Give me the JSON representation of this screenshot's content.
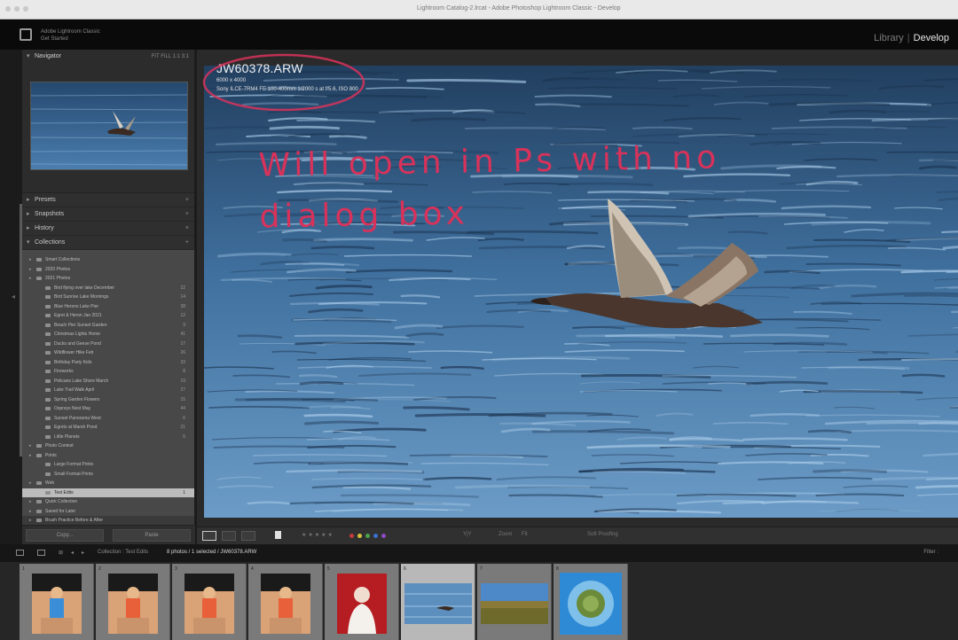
{
  "window": {
    "title": "Lightroom Catalog-2.lrcat - Adobe Photoshop Lightroom Classic - Develop"
  },
  "identity_plate": {
    "line1": "Adobe Lightroom Classic",
    "line2": "Get Started"
  },
  "modules": {
    "library": "Library",
    "separator": "|",
    "develop": "Develop"
  },
  "left_panel": {
    "navigator": {
      "label": "Navigator",
      "zoom": "FIT  FILL  1:1  3:1"
    },
    "sections": [
      {
        "label": "Presets"
      },
      {
        "label": "Snapshots"
      },
      {
        "label": "History"
      },
      {
        "label": "Collections"
      }
    ],
    "collections": [
      {
        "label": "Smart Collections",
        "count": "",
        "indent": 1
      },
      {
        "label": "2020 Photos",
        "count": "",
        "indent": 1
      },
      {
        "label": "2021 Photos",
        "count": "",
        "indent": 1
      },
      {
        "label": "Bird flying over lake December",
        "count": "22",
        "indent": 2
      },
      {
        "label": "Bird Sunrise Lake Mornings",
        "count": "14",
        "indent": 2
      },
      {
        "label": "Blue Herons Lake Pier",
        "count": "38",
        "indent": 2
      },
      {
        "label": "Egret & Heron Jan 2021",
        "count": "12",
        "indent": 2
      },
      {
        "label": "Beach Pier Sunset Garden",
        "count": "9",
        "indent": 2
      },
      {
        "label": "Christmas Lights Home",
        "count": "41",
        "indent": 2
      },
      {
        "label": "Ducks and Geese Pond",
        "count": "17",
        "indent": 2
      },
      {
        "label": "Wildflower Hike Feb",
        "count": "26",
        "indent": 2
      },
      {
        "label": "Birthday Party Kids",
        "count": "33",
        "indent": 2
      },
      {
        "label": "Fireworks",
        "count": "8",
        "indent": 2
      },
      {
        "label": "Pelicans Lake Shore March",
        "count": "19",
        "indent": 2
      },
      {
        "label": "Lake Trail Walk April",
        "count": "27",
        "indent": 2
      },
      {
        "label": "Spring Garden Flowers",
        "count": "15",
        "indent": 2
      },
      {
        "label": "Ospreys Nest May",
        "count": "44",
        "indent": 2
      },
      {
        "label": "Sunset Panorama West",
        "count": "6",
        "indent": 2
      },
      {
        "label": "Egrets at Marsh Pond",
        "count": "21",
        "indent": 2
      },
      {
        "label": "Little Planets",
        "count": "5",
        "indent": 2
      },
      {
        "label": "Photo Contest",
        "count": "",
        "indent": 1
      },
      {
        "label": "Prints",
        "count": "",
        "indent": 1
      },
      {
        "label": "Large Format Prints",
        "count": "",
        "indent": 2
      },
      {
        "label": "Small Format Prints",
        "count": "",
        "indent": 2
      },
      {
        "label": "Web",
        "count": "",
        "indent": 1
      },
      {
        "label": "Test Edits",
        "count": "1",
        "indent": 2,
        "selected": true
      },
      {
        "label": "Quick Collection",
        "count": "",
        "indent": 1
      },
      {
        "label": "Saved for Later",
        "count": "",
        "indent": 1
      },
      {
        "label": "Brush Practice Before & After",
        "count": "",
        "indent": 1
      }
    ],
    "buttons": {
      "copy": "Copy...",
      "paste": "Paste"
    }
  },
  "info_overlay": {
    "filename": "JW60378.ARW",
    "dimensions": "6000 x 4000",
    "exif": "Sony ILCE-7RM4 FE 100-400mm  1/2000 s at f/5.6, ISO 800"
  },
  "annotation": {
    "line1": "Will open in Ps with no",
    "line2": "dialog box",
    "color": "#d8325a"
  },
  "toolbar": {
    "soft_proofing": "Soft Proofing",
    "before_after": "Y|Y",
    "zoom_label": "Zoom",
    "zoom_value": "Fit"
  },
  "filmstrip_bar": {
    "source": "Collection : Test Edits",
    "count": "8 photos / 1 selected / JW60378.ARW",
    "filter": "Filter :"
  },
  "filmstrip": {
    "items": [
      {
        "num": "1",
        "subject": "girl-blue-dress"
      },
      {
        "num": "2",
        "subject": "girl-orange-dress"
      },
      {
        "num": "3",
        "subject": "girl-orange-dress"
      },
      {
        "num": "4",
        "subject": "girl-orange-dress"
      },
      {
        "num": "5",
        "subject": "portrait-red-background"
      },
      {
        "num": "6",
        "subject": "bird-over-water",
        "selected": true
      },
      {
        "num": "7",
        "subject": "landscape-field"
      },
      {
        "num": "8",
        "subject": "little-planet"
      }
    ]
  },
  "colors": {
    "accent_highlight": "#d8325a",
    "panel": "#3a3a3a",
    "background": "#1b1b1b",
    "water": "#3d6d9a"
  }
}
